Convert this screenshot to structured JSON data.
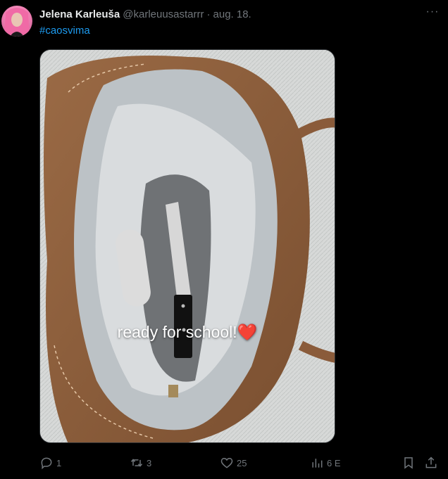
{
  "author": {
    "display_name": "Jelena Karleuša",
    "handle": "@karleuusastarrr",
    "separator": "·",
    "date": "aug. 18."
  },
  "more_label": "···",
  "tweet_text": "#caosvima",
  "media": {
    "caption": "ready for school!❤️"
  },
  "actions": {
    "reply_count": "1",
    "retweet_count": "3",
    "like_count": "25",
    "views_count": "6 E"
  },
  "icons": {
    "reply": "reply-icon",
    "retweet": "retweet-icon",
    "like": "heart-icon",
    "views": "views-chart-icon",
    "bookmark": "bookmark-icon",
    "share": "share-icon",
    "more": "more-icon"
  },
  "colors": {
    "background": "#000000",
    "text": "#e7e9ea",
    "muted": "#71767b",
    "link": "#1d9bf0"
  }
}
